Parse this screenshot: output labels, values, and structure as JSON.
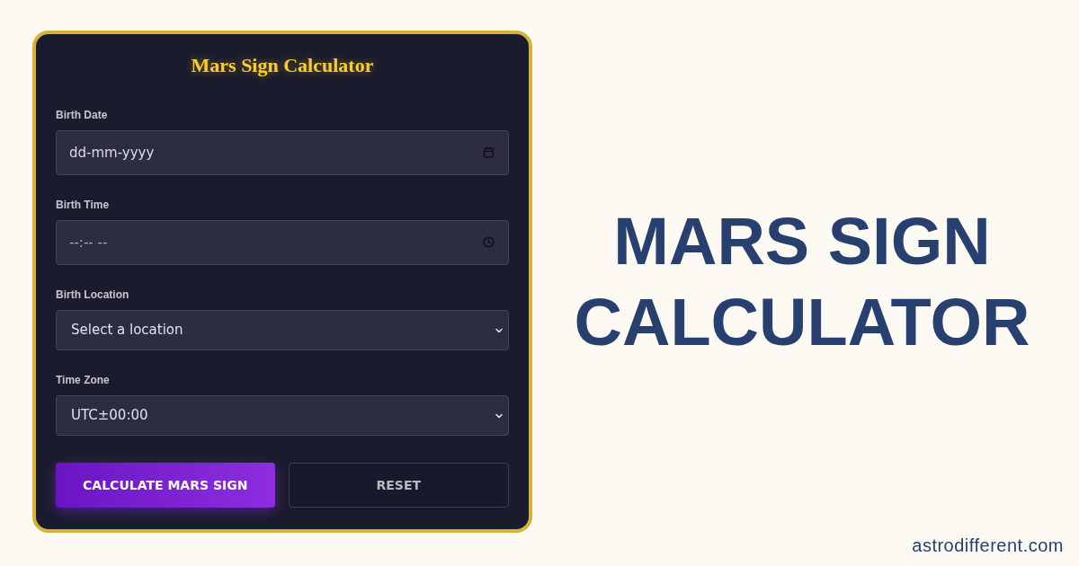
{
  "form": {
    "title": "Mars Sign Calculator",
    "fields": [
      {
        "kind": "date",
        "label": "Birth Date",
        "placeholder": "dd-mm-yyyy"
      },
      {
        "kind": "time",
        "label": "Birth Time",
        "placeholder": "--:-- --"
      },
      {
        "kind": "select",
        "label": "Birth Location",
        "value": "Select a location"
      },
      {
        "kind": "select",
        "label": "Time Zone",
        "value": "UTC±00:00"
      }
    ],
    "buttons": [
      {
        "kind": "primary",
        "label": "CALCULATE MARS SIGN"
      },
      {
        "kind": "secondary",
        "label": "RESET"
      }
    ]
  },
  "headline": [
    "MARS SIGN",
    "CALCULATOR"
  ],
  "site_url": "astrodifferent.com"
}
